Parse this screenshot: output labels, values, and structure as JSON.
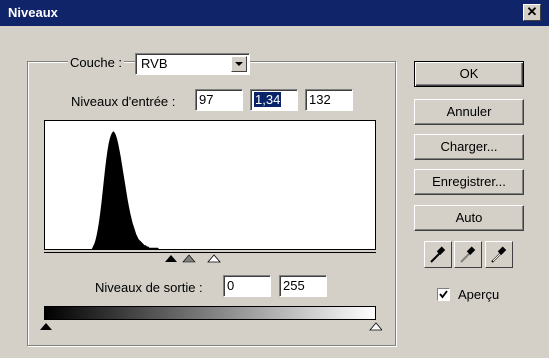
{
  "window": {
    "title": "Niveaux",
    "close_glyph": "✕"
  },
  "channel": {
    "label": "Couche :",
    "value": "RVB"
  },
  "input_levels": {
    "label": "Niveaux d'entrée :",
    "black": "97",
    "gamma": "1,34",
    "white": "132"
  },
  "output_levels": {
    "label": "Niveaux de sortie :",
    "black": "0",
    "white": "255"
  },
  "histogram": {
    "type": "area",
    "x_range": [
      0,
      255
    ],
    "values": [
      0,
      0,
      0,
      0,
      0,
      0,
      0,
      0,
      0,
      0,
      0,
      0,
      0,
      0,
      0,
      0,
      0,
      0,
      0,
      0,
      0,
      0,
      0,
      0,
      0,
      0,
      0,
      0,
      0,
      0,
      0,
      0,
      0,
      0,
      0,
      0,
      0,
      0,
      0,
      0,
      2,
      4,
      7,
      11,
      16,
      22,
      29,
      37,
      46,
      55,
      64,
      72,
      79,
      85,
      89,
      92,
      94,
      95,
      94,
      92,
      89,
      85,
      80,
      75,
      69,
      63,
      57,
      51,
      45,
      39,
      34,
      29,
      25,
      21,
      18,
      15,
      12,
      10,
      8,
      7,
      6,
      5,
      4,
      3,
      3,
      2,
      2,
      1,
      1,
      1,
      1,
      1,
      1,
      1,
      1,
      0,
      0,
      0,
      0,
      0,
      0,
      0,
      0,
      0,
      0,
      0,
      0,
      0,
      0,
      0,
      0,
      0,
      0,
      0,
      0,
      0,
      0,
      0,
      0,
      0,
      0,
      0,
      0,
      0,
      0,
      0,
      0,
      0,
      0,
      0,
      0,
      0,
      0,
      0,
      0,
      0,
      0,
      0,
      0,
      0,
      0,
      0,
      0,
      0,
      0,
      0,
      0,
      0,
      0,
      0,
      0,
      0,
      0,
      0,
      0,
      0,
      0,
      0,
      0,
      0,
      0,
      0,
      0,
      0,
      0,
      0,
      0,
      0,
      0,
      0,
      0,
      0,
      0,
      0,
      0,
      0,
      0,
      0,
      0,
      0,
      0,
      0,
      0,
      0,
      0,
      0,
      0,
      0,
      0,
      0,
      0,
      0,
      0,
      0,
      0,
      0,
      0,
      0,
      0,
      0,
      0,
      0,
      0,
      0,
      0,
      0,
      0,
      0,
      0,
      0,
      0,
      0,
      0,
      0,
      0,
      0,
      0,
      0,
      0,
      0,
      0,
      0,
      0,
      0,
      0,
      0,
      0,
      0,
      0,
      0,
      0,
      0,
      0,
      0,
      0,
      0,
      0,
      0,
      0,
      0,
      0,
      0,
      0,
      0,
      0,
      0,
      0,
      0,
      0,
      0,
      0,
      0,
      0,
      0,
      0,
      0,
      0,
      0,
      0,
      0,
      0,
      0,
      0,
      0,
      0,
      0,
      0,
      0,
      0,
      0,
      0,
      0,
      0,
      0,
      0,
      0
    ]
  },
  "buttons": {
    "ok": "OK",
    "cancel": "Annuler",
    "load": "Charger...",
    "save": "Enregistrer...",
    "auto": "Auto"
  },
  "preview": {
    "label": "Aperçu",
    "checked": true
  },
  "icons": {
    "black_eyedropper": "eyedropper-black-icon",
    "gray_eyedropper": "eyedropper-gray-icon",
    "white_eyedropper": "eyedropper-white-icon"
  },
  "colors": {
    "title_bar": "#10246a",
    "dialog_bg": "#d4d0c8",
    "selection": "#0a246a"
  }
}
